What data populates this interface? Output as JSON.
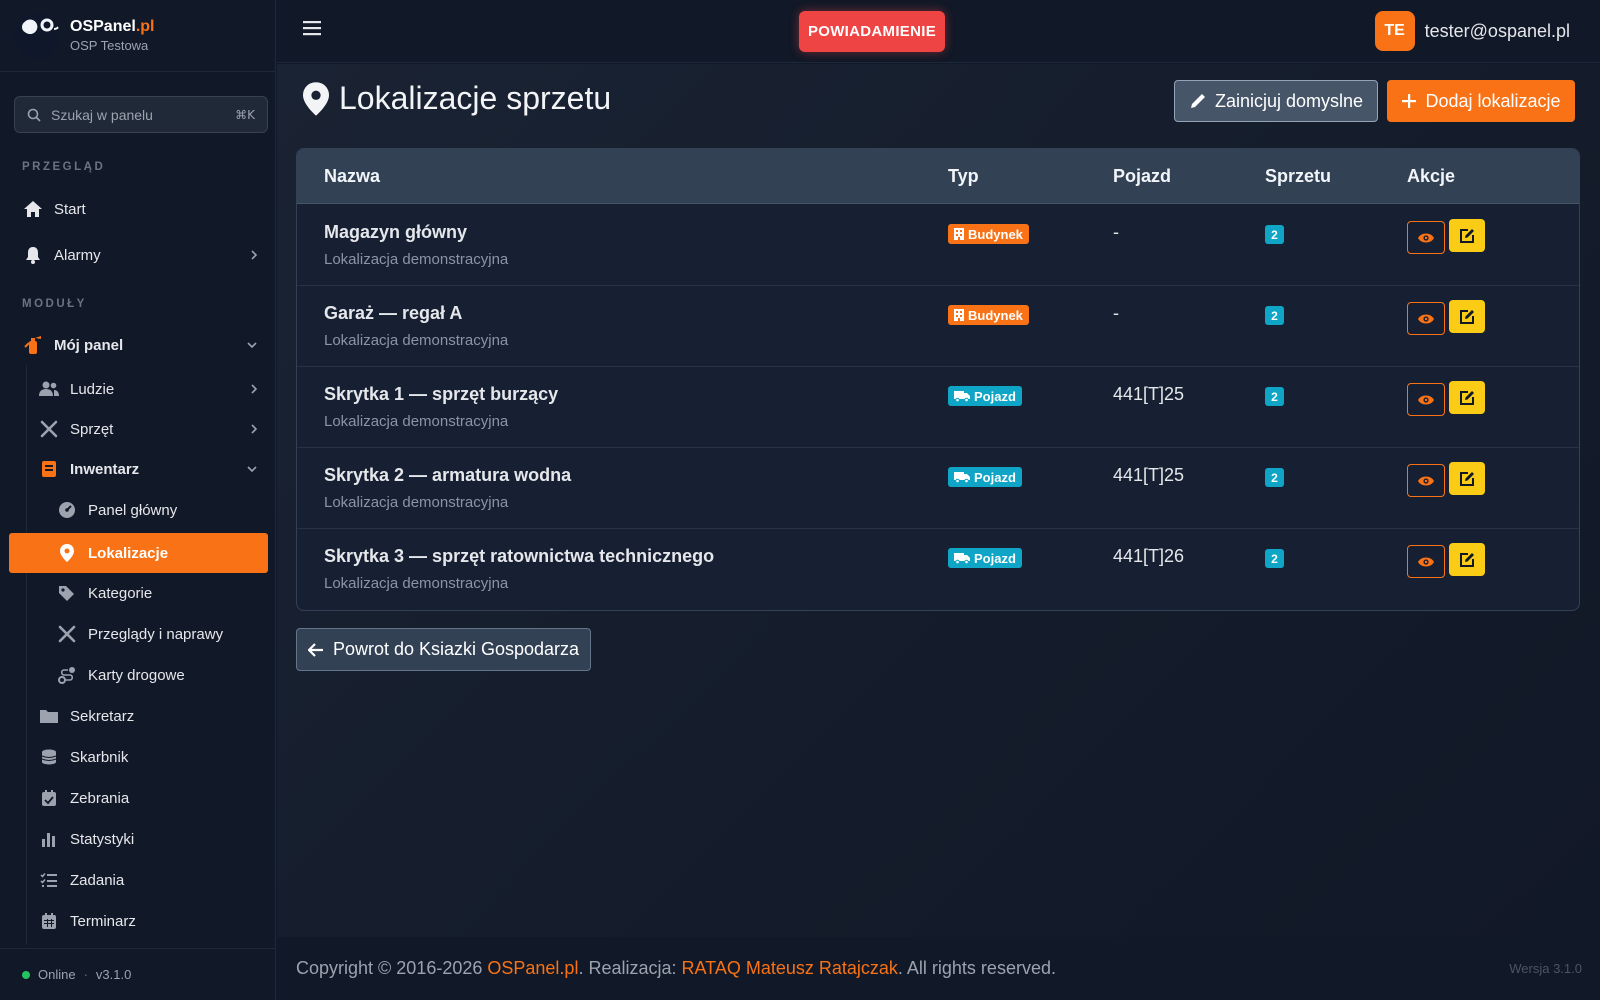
{
  "brand": {
    "name": "OSPanel",
    "tld": ".pl",
    "subtitle": "OSP Testowa"
  },
  "search": {
    "placeholder": "Szukaj w panelu",
    "shortcut": "⌘K"
  },
  "sidebar": {
    "section_overview": "PRZEGLĄD",
    "section_modules": "MODUŁY",
    "start": "Start",
    "alarms": "Alarmy",
    "my_panel": "Mój panel",
    "people": "Ludzie",
    "equipment": "Sprzęt",
    "inventory": "Inwentarz",
    "main_panel": "Panel główny",
    "locations": "Lokalizacje",
    "categories": "Kategorie",
    "inspections": "Przeglądy i naprawy",
    "road_cards": "Karty drogowe",
    "secretary": "Sekretarz",
    "treasurer": "Skarbnik",
    "meetings": "Zebrania",
    "stats": "Statystyki",
    "tasks": "Zadania",
    "calendar": "Terminarz",
    "status": "Online",
    "version": "v3.1.0"
  },
  "topbar": {
    "notify_label": "POWIADAMIENIE",
    "avatar_initials": "TE",
    "user_email": "tester@ospanel.pl"
  },
  "page": {
    "title": "Lokalizacje sprzetu",
    "init_label": "Zainicjuj domyslne",
    "add_label": "Dodaj lokalizacje",
    "back_label": "Powrot do Ksiazki Gospodarza"
  },
  "table": {
    "headers": {
      "name": "Nazwa",
      "type": "Typ",
      "vehicle": "Pojazd",
      "count": "Sprzetu",
      "actions": "Akcje"
    },
    "rows": [
      {
        "name": "Magazyn główny",
        "desc": "Lokalizacja demonstracyjna",
        "type": "Budynek",
        "vehicle": "-",
        "count": "2"
      },
      {
        "name": "Garaż — regał A",
        "desc": "Lokalizacja demonstracyjna",
        "type": "Budynek",
        "vehicle": "-",
        "count": "2"
      },
      {
        "name": "Skrytka 1 — sprzęt burzący",
        "desc": "Lokalizacja demonstracyjna",
        "type": "Pojazd",
        "vehicle": "441[T]25",
        "count": "2"
      },
      {
        "name": "Skrytka 2 — armatura wodna",
        "desc": "Lokalizacja demonstracyjna",
        "type": "Pojazd",
        "vehicle": "441[T]25",
        "count": "2"
      },
      {
        "name": "Skrytka 3 — sprzęt ratownictwa technicznego",
        "desc": "Lokalizacja demonstracyjna",
        "type": "Pojazd",
        "vehicle": "441[T]26",
        "count": "2"
      }
    ]
  },
  "footer": {
    "copyright": "Copyright © 2016-2026 ",
    "brand_link": "OSPanel.pl",
    "realization": ". Realizacja: ",
    "author_link": "RATAQ Mateusz Ratajczak",
    "rights": ". All rights reserved.",
    "version": "Wersja 3.1.0"
  },
  "colors": {
    "accent": "#f97316",
    "notify": "#ef4444",
    "teal": "#0ea5c6",
    "edit": "#facc15"
  }
}
